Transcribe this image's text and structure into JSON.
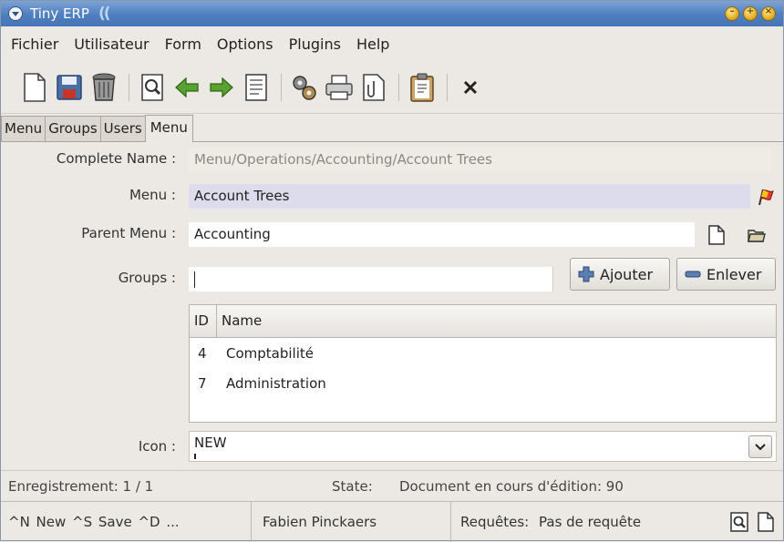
{
  "window": {
    "title": "Tiny ERP",
    "title_decoration": "(("
  },
  "menubar": {
    "items": [
      "Fichier",
      "Utilisateur",
      "Form",
      "Options",
      "Plugins",
      "Help"
    ]
  },
  "toolbar": {
    "buttons": [
      "new-icon",
      "save-icon",
      "delete-icon",
      "find-icon",
      "previous-icon",
      "next-icon",
      "switch-view-icon",
      "action-icon",
      "print-icon",
      "attachment-icon",
      "clipboard-icon",
      "close-icon"
    ]
  },
  "tabs": [
    {
      "label": "Menu",
      "active": false
    },
    {
      "label": "Groups",
      "active": false
    },
    {
      "label": "Users",
      "active": false
    },
    {
      "label": "Menu",
      "active": true
    }
  ],
  "form": {
    "complete_name": {
      "label": "Complete Name :",
      "value": "Menu/Operations/Accounting/Account Trees"
    },
    "menu": {
      "label": "Menu :",
      "value": "Account Trees"
    },
    "parent_menu": {
      "label": "Parent Menu :",
      "value": "Accounting"
    },
    "groups": {
      "label": "Groups :",
      "input_value": "",
      "add_label": "Ajouter",
      "remove_label": "Enlever",
      "columns": [
        "ID",
        "Name"
      ],
      "rows": [
        {
          "id": "4",
          "name": "Comptabilité"
        },
        {
          "id": "7",
          "name": "Administration"
        }
      ]
    },
    "icon": {
      "label": "Icon :",
      "value": "NEW"
    }
  },
  "status": {
    "record": "Enregistrement: 1 / 1",
    "state_label": "State:",
    "state_value": "Document en cours d'édition: 90"
  },
  "bottombar": {
    "shortcuts": "^N New  ^S Save  ^D ...",
    "user": "Fabien Pinckaers",
    "requests_label": "Requêtes:",
    "requests_value": "Pas de requête"
  },
  "colors": {
    "titlebar": "#4f7fbf",
    "required_field": "#dcdced",
    "readonly_field": "#efece6"
  }
}
